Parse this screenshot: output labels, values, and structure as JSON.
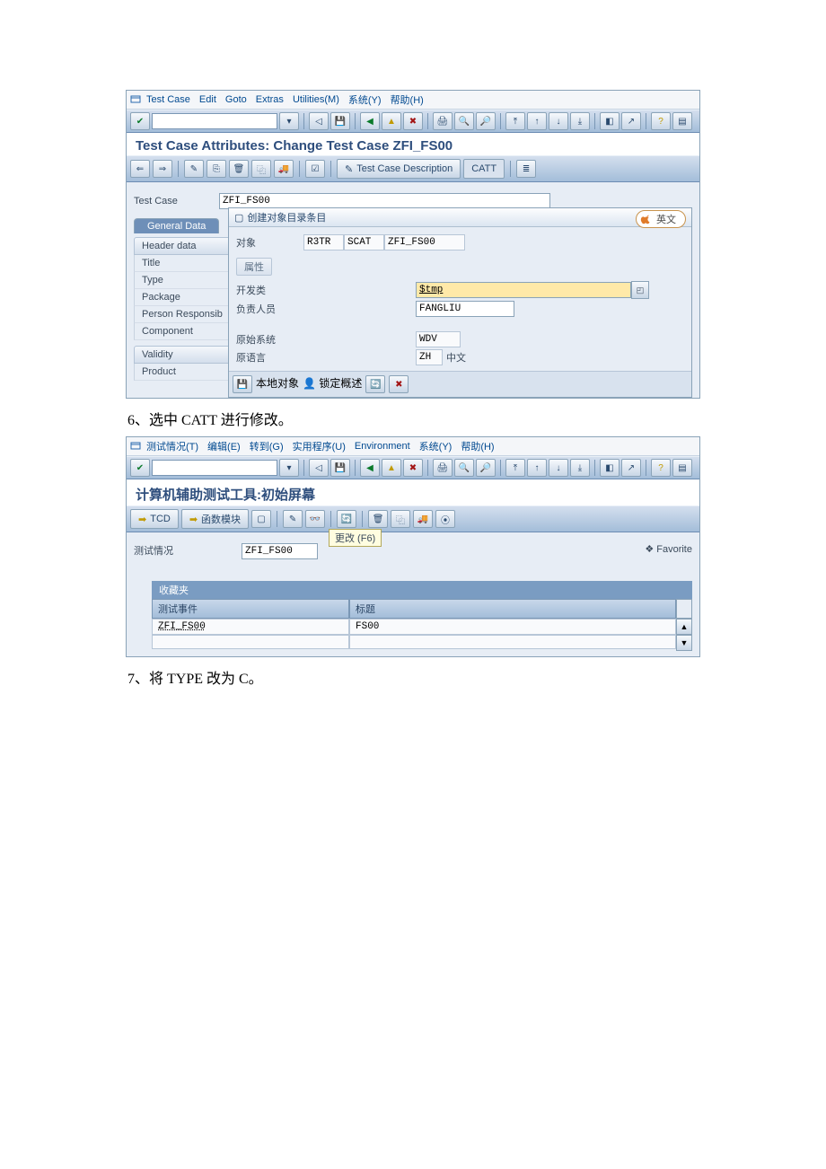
{
  "screenshot1": {
    "menu": [
      "Test Case",
      "Edit",
      "Goto",
      "Extras",
      "Utilities(M)",
      "系统(Y)",
      "帮助(H)"
    ],
    "title": "Test Case Attributes: Change Test Case ZFI_FS00",
    "app_buttons": {
      "desc": "Test Case Description",
      "catt": "CATT"
    },
    "test_case_label": "Test Case",
    "test_case_value": "ZFI_FS00",
    "tabs": {
      "general": "General Data"
    },
    "side": [
      "Header data",
      "Title",
      "Type",
      "Package",
      "Person Responsib",
      "Component",
      "Validity",
      "Product"
    ],
    "popup": {
      "header": "创建对象目录条目",
      "lang_pill": "英文",
      "object_label": "对象",
      "object_v1": "R3TR",
      "object_v2": "SCAT",
      "object_v3": "ZFI_FS00",
      "section_attr": "属性",
      "dev_class_label": "开发类",
      "dev_class_value": "$tmp",
      "resp_label": "负责人员",
      "resp_value": "FANGLIU",
      "orig_sys_label": "原始系统",
      "orig_sys_value": "WDV",
      "orig_lang_label": "原语言",
      "orig_lang_code": "ZH",
      "orig_lang_name": "中文",
      "footer": {
        "local": "本地对象",
        "lock": "锁定概述"
      }
    }
  },
  "para6": "6、选中 CATT 进行修改。",
  "screenshot2": {
    "menu": [
      "测试情况(T)",
      "编辑(E)",
      "转到(G)",
      "实用程序(U)",
      "Environment",
      "系统(Y)",
      "帮助(H)"
    ],
    "title": "计算机辅助测试工具:初始屏幕",
    "appbar": {
      "tcd": "TCD",
      "func": "函数模块",
      "change_tip": "更改  (F6)"
    },
    "test_case_label": "测试情况",
    "test_case_value": "ZFI_FS00",
    "favorite_btn": "Favorite",
    "fav_header": "收藏夹",
    "grid": {
      "col1": "测试事件",
      "col2": "标题",
      "row_event": "ZFI_FS00",
      "row_title": "FS00"
    }
  },
  "para7": "7、将 TYPE 改为 C。"
}
